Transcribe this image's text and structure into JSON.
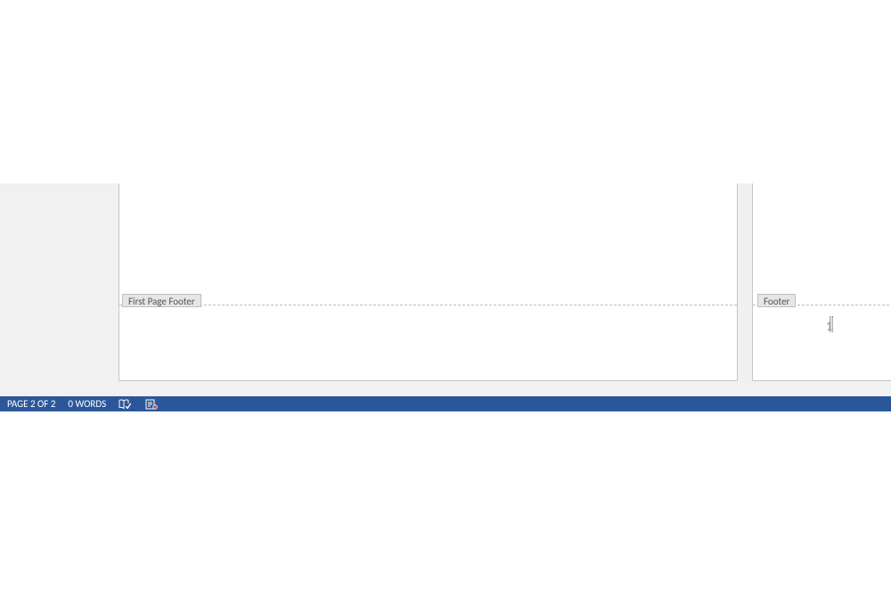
{
  "pages": {
    "first": {
      "footer_tag": "First Page Footer"
    },
    "second": {
      "footer_tag": "Footer",
      "page_number": "1"
    }
  },
  "status": {
    "page_info": "PAGE 2 OF 2",
    "word_count": "0 WORDS"
  }
}
